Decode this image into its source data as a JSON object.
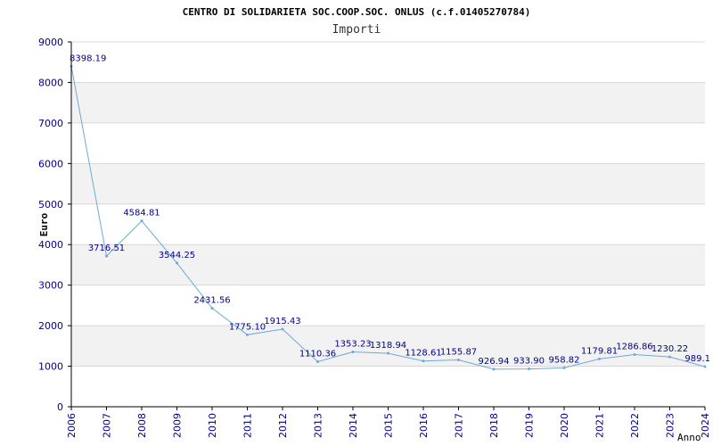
{
  "chart_data": {
    "type": "line",
    "title": "CENTRO DI SOLIDARIETA SOC.COOP.SOC. ONLUS (c.f.01405270784)",
    "subtitle": "Importi",
    "xlabel": "Anno",
    "ylabel": "Euro",
    "ylim": [
      0,
      9000
    ],
    "yticks": [
      0,
      1000,
      2000,
      3000,
      4000,
      5000,
      6000,
      7000,
      8000,
      9000
    ],
    "grid": true,
    "categories": [
      "2006",
      "2007",
      "2008",
      "2009",
      "2010",
      "2011",
      "2012",
      "2013",
      "2014",
      "2015",
      "2016",
      "2017",
      "2018",
      "2019",
      "2020",
      "2021",
      "2022",
      "2023",
      "2024"
    ],
    "values": [
      8398.19,
      3716.51,
      4584.81,
      3544.25,
      2431.56,
      1775.1,
      1915.43,
      1110.36,
      1353.23,
      1318.94,
      1128.61,
      1155.87,
      926.94,
      933.9,
      958.82,
      1179.81,
      1286.86,
      1230.22,
      989.1
    ],
    "value_labels": [
      "8398.19",
      "3716.51",
      "4584.81",
      "3544.25",
      "2431.56",
      "1775.10",
      "1915.43",
      "1110.36",
      "1353.23",
      "1318.94",
      "1128.61",
      "1155.87",
      "926.94",
      "933.90",
      "958.82",
      "1179.81",
      "1286.86",
      "1230.22",
      "989.1"
    ],
    "colors": {
      "line": "#6fa8dc",
      "band": "#f2f2f2",
      "grid": "#d8d8d8",
      "axis": "#000000",
      "text": "#00008b"
    }
  }
}
